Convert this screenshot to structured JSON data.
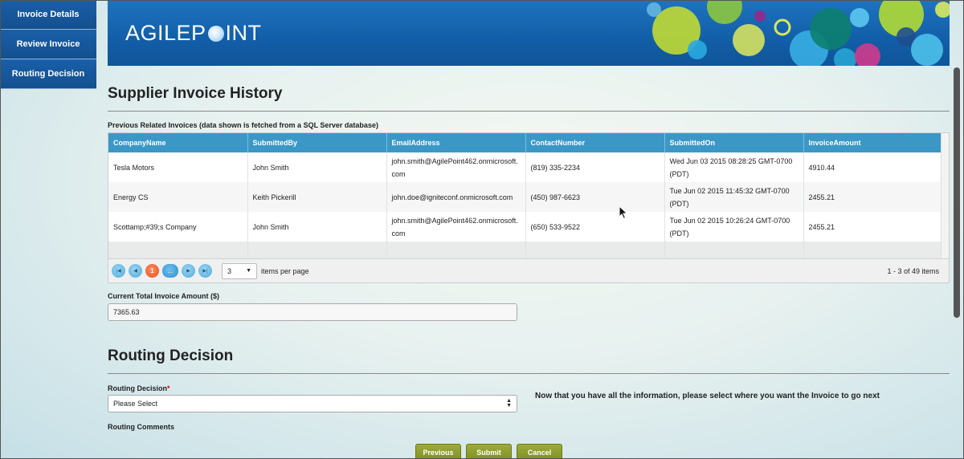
{
  "sidebar": {
    "items": [
      {
        "label": "Invoice Details"
      },
      {
        "label": "Review Invoice"
      },
      {
        "label": "Routing Decision"
      }
    ]
  },
  "header": {
    "logo_left": "AGILEP",
    "logo_right": "INT",
    "brand_color": "#125ea8"
  },
  "history": {
    "title": "Supplier Invoice History",
    "grid_caption": "Previous Related Invoices (data shown is fetched from a SQL Server database)",
    "columns": [
      "CompanyName",
      "SubmittedBy",
      "EmailAddress",
      "ContactNumber",
      "SubmittedOn",
      "InvoiceAmount"
    ],
    "rows": [
      [
        "Tesla Motors",
        "John Smith",
        "john.smith@AgilePoint462.onmicrosoft.com",
        "(819) 335-2234",
        "Wed Jun 03 2015 08:28:25 GMT-0700 (PDT)",
        "4910.44"
      ],
      [
        "Energy CS",
        "Keith Pickerill",
        "john.doe@igniteconf.onmicrosoft.com",
        "(450) 987-6623",
        "Tue Jun 02 2015 11:45:32 GMT-0700 (PDT)",
        "2455.21"
      ],
      [
        "Scottamp;#39;s Company",
        "John Smith",
        "john.smith@AgilePoint462.onmicrosoft.com",
        "(650) 533-9522",
        "Tue Jun 02 2015 10:26:24 GMT-0700 (PDT)",
        "2455.21"
      ]
    ],
    "pager": {
      "current_page": "1",
      "more": "...",
      "page_size": "3",
      "page_size_label": "items per page",
      "info": "1 - 3 of 49 items"
    }
  },
  "total": {
    "label": "Current Total Invoice Amount ($)",
    "value": "7365.63"
  },
  "routing": {
    "title": "Routing Decision",
    "field_label": "Routing Decision",
    "required_mark": "*",
    "select_value": "Please Select",
    "help": "Now that you have all the information, please select where you want the Invoice to go next",
    "comments_label": "Routing Comments"
  },
  "buttons": {
    "previous": "Previous",
    "submit": "Submit",
    "cancel": "Cancel"
  }
}
